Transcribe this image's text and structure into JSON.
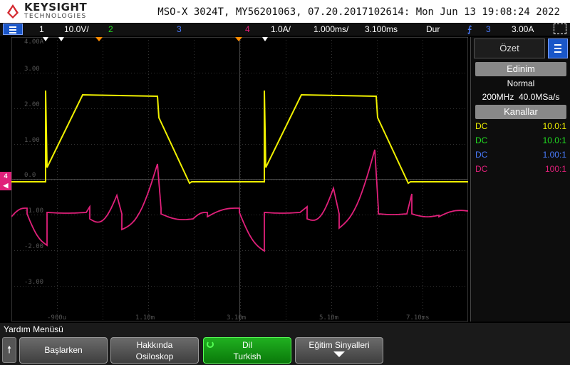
{
  "header": {
    "brand": "KEYSIGHT",
    "brand_sub": "TECHNOLOGIES",
    "title": "MSO-X 3024T, MY56201063, 07.20.2017102614: Mon Jun 13 19:08:24 2022"
  },
  "status_bar": {
    "ch1_num": "1",
    "ch1_scale": "10.0V/",
    "ch2_num": "2",
    "ch3_num": "3",
    "ch4_num": "4",
    "ch4_scale": "1.0A/",
    "timebase": "1.000ms/",
    "delay": "3.100ms",
    "trigger_mode": "Dur",
    "trigger_source": "3",
    "trigger_level": "3.00A"
  },
  "grid": {
    "y_labels": [
      "4.00A",
      "3.00",
      "2.00",
      "1.00",
      "0.0",
      "-1.00",
      "-2.00",
      "-3.00"
    ],
    "x_labels": [
      "-900u",
      "1.10m",
      "3.10m",
      "5.10m",
      "7.10ms"
    ],
    "ch4_marker": "4"
  },
  "panel": {
    "tab_label": "Özet",
    "acq_header": "Edinim",
    "acq_mode": "Normal",
    "acq_rate": "200MHz  40.0MSa/s",
    "channels_header": "Kanallar",
    "channels": [
      {
        "coupling": "DC",
        "probe": "10.0:1",
        "color": "#f0f000"
      },
      {
        "coupling": "DC",
        "probe": "10.0:1",
        "color": "#22dd22"
      },
      {
        "coupling": "DC",
        "probe": "1.00:1",
        "color": "#4a7cff"
      },
      {
        "coupling": "DC",
        "probe": "100:1",
        "color": "#e0207a"
      }
    ]
  },
  "softkeys": {
    "menu_label": "Yardım Menüsü",
    "key1": "Başlarken",
    "key2_line1": "Hakkında",
    "key2_line2": "Osiloskop",
    "key3_line1": "Dil",
    "key3_line2": "Turkish",
    "key4": "Eğitim Sinyalleri"
  },
  "colors": {
    "ch1": "#f0f000",
    "ch2": "#22dd22",
    "ch3": "#4a7cff",
    "ch4": "#e0207a"
  },
  "icons": [
    "keysight-logo-icon",
    "menu-icon",
    "trigger-edge-icon",
    "cursor-icon",
    "back-arrow-icon",
    "knob-icon",
    "down-arrow-icon"
  ]
}
